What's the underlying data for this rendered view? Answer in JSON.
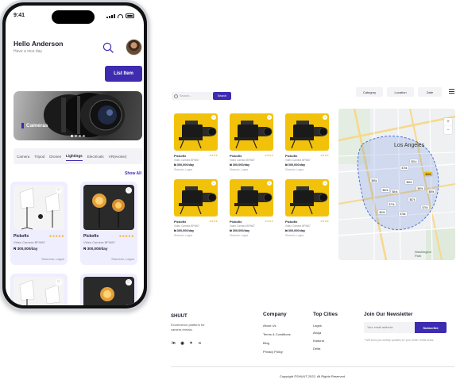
{
  "phone": {
    "status_time": "9:41",
    "greeting": "Hello Anderson",
    "greeting_sub": "Have a nice day",
    "list_item_button": "List Item",
    "hero_label": "Cameras",
    "tabs": [
      "Camera",
      "Tripod",
      "Drones",
      "Lightings",
      "Electricals",
      "VR(evolve)"
    ],
    "active_tab": "Lightings",
    "show_all": "Show All",
    "cards": [
      {
        "name": "Pickofix",
        "stars": "★★★★★",
        "desc": "Video Camera BFW67",
        "price": "₦ 300,000/day",
        "location": "Shomolu, Lagos"
      },
      {
        "name": "Pickofix",
        "stars": "★★★★★",
        "desc": "Video Camera BFW67",
        "price": "₦ 300,000/day",
        "location": "Shomolu, Lagos"
      }
    ]
  },
  "desktop": {
    "search_placeholder": "Search...",
    "search_button": "Search",
    "filters": [
      "Category",
      "Location",
      "Date"
    ],
    "cards": [
      {
        "name": "Pickofix",
        "stars": "★★★★",
        "desc": "Video Camera BFW67",
        "price": "₦ 300,000/day",
        "location": "Shomolu, Lagos"
      },
      {
        "name": "Pickofix",
        "stars": "★★★★",
        "desc": "Video Camera BFW67",
        "price": "₦ 300,000/day",
        "location": "Shomolu, Lagos"
      },
      {
        "name": "Pickofix",
        "stars": "★★★★",
        "desc": "Video Camera BFW67",
        "price": "₦ 300,000/day",
        "location": "Shomolu, Lagos"
      },
      {
        "name": "Pickofix",
        "stars": "★★★★",
        "desc": "Video Camera BFW67",
        "price": "₦ 300,000/day",
        "location": "Shomolu, Lagos"
      },
      {
        "name": "Pickofix",
        "stars": "★★★★",
        "desc": "Video Camera BFW67",
        "price": "₦ 300,000/day",
        "location": "Shomolu, Lagos"
      },
      {
        "name": "Pickofix",
        "stars": "★★★★",
        "desc": "Video Camera BFW67",
        "price": "₦ 300,000/day",
        "location": "Shomolu, Lagos"
      }
    ],
    "map": {
      "city_label": "Los Angeles",
      "park_label": "Washington Park",
      "zoom_in": "+",
      "zoom_out": "−",
      "pins": [
        "$65k",
        "$82k",
        "$75k",
        "$91k",
        "$68k",
        "$80k",
        "$72k",
        "$87k",
        "$63k",
        "$78k",
        "$70k",
        "$84k",
        "$66k",
        "$89k"
      ]
    }
  },
  "footer": {
    "brand": "SHUUT",
    "tagline": "Ecommerce platform for camera rentals.",
    "social_icons": [
      "linkedin-icon",
      "whatsapp-icon",
      "twitter-icon",
      "link-icon"
    ],
    "company_heading": "Company",
    "company_links": [
      "About Us",
      "Terms & Conditions",
      "Blog",
      "Privacy Policy"
    ],
    "cities_heading": "Top Cities",
    "cities": [
      "Lagos",
      "Abuja",
      "Kaduna",
      "Delta"
    ],
    "newsletter_heading": "Join Our Newsletter",
    "newsletter_placeholder": "Your email address",
    "subscribe": "Subscribe",
    "newsletter_note": "* Will send you weekly updates for your better rental deals.",
    "copyright": "Copyright ©SHUUT 2022. All Rights Reserved."
  },
  "colors": {
    "accent": "#3d2bb0",
    "yellow": "#f2c10a",
    "star": "#f0b429"
  }
}
